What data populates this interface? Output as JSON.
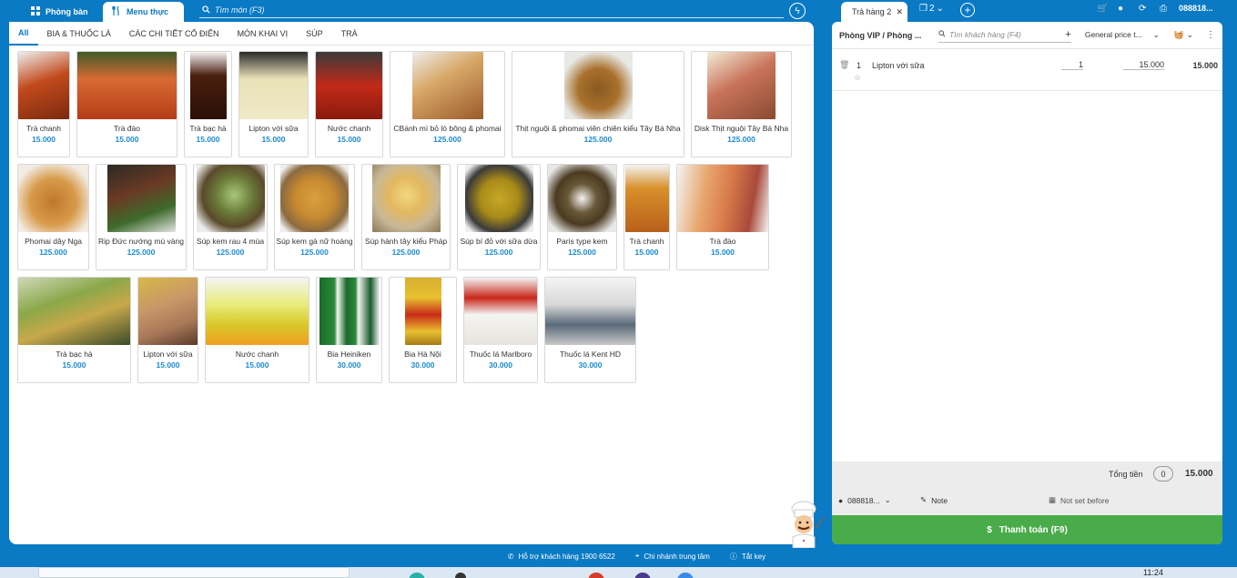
{
  "topbar": {
    "tab_rooms": "Phòng bàn",
    "tab_menu": "Menu thực",
    "search_placeholder": "Tìm món (F3)"
  },
  "categories": [
    "All",
    "BIA & THUỐC LÁ",
    "CÁC CHI TIẾT CỔ ĐIỂN",
    "MÓN KHAI VỊ",
    "SÚP",
    "TRÀ"
  ],
  "rows": [
    [
      {
        "name": "Trà chanh",
        "price": "15.000"
      },
      {
        "name": "Trà đào",
        "price": "15.000"
      },
      {
        "name": "Trà bạc hà",
        "price": "15.000"
      },
      {
        "name": "Lipton với sữa",
        "price": "15.000"
      },
      {
        "name": "Nước chanh",
        "price": "15.000"
      },
      {
        "name": "CBánh mì bỏ lò bông & phomai",
        "price": "125.000"
      },
      {
        "name": "Thịt nguội & phomai viên chiên kiểu Tây Bá Nha",
        "price": "125.000"
      },
      {
        "name": "Disk Thịt nguội Tây Bá Nha",
        "price": "125.000"
      }
    ],
    [
      {
        "name": "Phomai dây Nga",
        "price": "125.000"
      },
      {
        "name": "Rip Đức nướng mù vàng",
        "price": "125.000"
      },
      {
        "name": "Súp kem rau 4 mùa",
        "price": "125.000"
      },
      {
        "name": "Súp kem gà nữ hoàng",
        "price": "125.000"
      },
      {
        "name": "Súp hành tây kiểu Pháp",
        "price": "125.000"
      },
      {
        "name": "Súp bí đỏ với sữa dừa",
        "price": "125.000"
      },
      {
        "name": "Paris type kem",
        "price": "125.000"
      },
      {
        "name": "Trà chanh",
        "price": "15.000"
      },
      {
        "name": "Trà đào",
        "price": "15.000"
      }
    ],
    [
      {
        "name": "Trà bạc hà",
        "price": "15.000"
      },
      {
        "name": "Lipton với sữa",
        "price": "15.000"
      },
      {
        "name": "Nước chanh",
        "price": "15.000"
      },
      {
        "name": "Bia Heiniken",
        "price": "30.000"
      },
      {
        "name": "Bia Hà Nội",
        "price": "30.000"
      },
      {
        "name": "Thuốc lá Marlboro",
        "price": "30.000"
      },
      {
        "name": "Thuốc lá Kent HD",
        "price": "30.000"
      }
    ]
  ],
  "order": {
    "tab_label": "Trả hàng 2",
    "tab_count": "2",
    "phone": "088818...",
    "room": "Phòng VIP / Phòng ...",
    "customer_placeholder": "Tìm khách hàng (F4)",
    "price_list": "General price t...",
    "line": {
      "index": "1",
      "name": "Lipton với sữa",
      "qty": "1",
      "price": "15.000",
      "total": "15.000"
    },
    "total_label": "Tổng tiền",
    "total_count": "0",
    "total_value": "15.000",
    "user": "088818...",
    "note_label": "Note",
    "not_set": "Not set before",
    "pay_label": "Thanh toán (F9)"
  },
  "status": {
    "support": "Hỗ trợ khách hàng 1900 6522",
    "branch": "Chi nhánh trung tâm",
    "key": "Tắt key",
    "clock": "11:24"
  },
  "colors": {
    "brand": "#0a7ac4",
    "price": "#1a8ad3",
    "pay": "#4aab4a"
  }
}
